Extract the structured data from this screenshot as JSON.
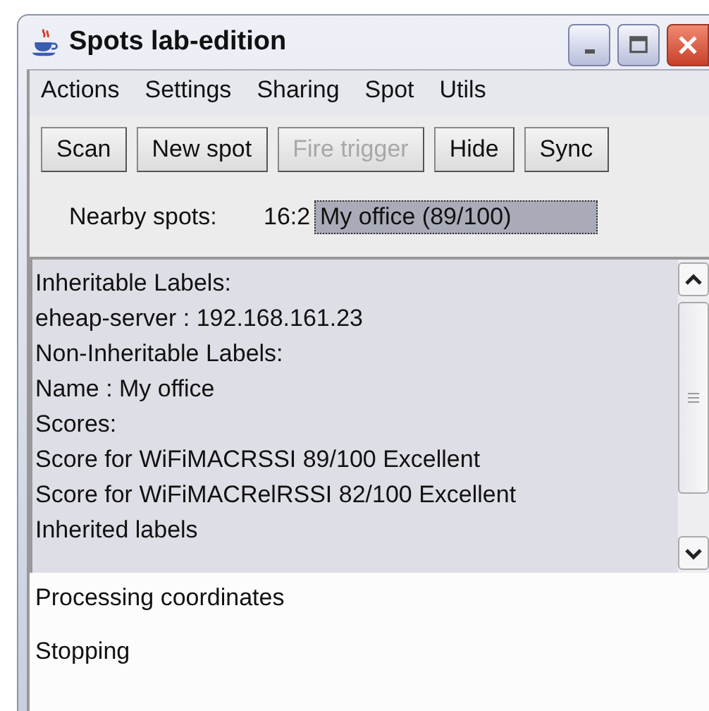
{
  "window": {
    "title": "Spots lab-edition"
  },
  "menu": [
    "Actions",
    "Settings",
    "Sharing",
    "Spot",
    "Utils"
  ],
  "buttons": [
    {
      "label": "Scan",
      "disabled": false
    },
    {
      "label": "New spot",
      "disabled": false
    },
    {
      "label": "Fire trigger",
      "disabled": true
    },
    {
      "label": "Hide",
      "disabled": false
    },
    {
      "label": "Sync",
      "disabled": false
    }
  ],
  "nearby": {
    "label": "Nearby spots:",
    "count": "16:2",
    "value": "My office (89/100)"
  },
  "details": [
    "Inheritable Labels:",
    "eheap-server : 192.168.161.23",
    "Non-Inheritable Labels:",
    "Name : My office",
    "Scores:",
    "Score for WiFiMACRSSI 89/100 Excellent",
    "Score for WiFiMACRelRSSI 82/100 Excellent",
    "Inherited labels"
  ],
  "log": [
    "Processing coordinates",
    "Stopping"
  ]
}
